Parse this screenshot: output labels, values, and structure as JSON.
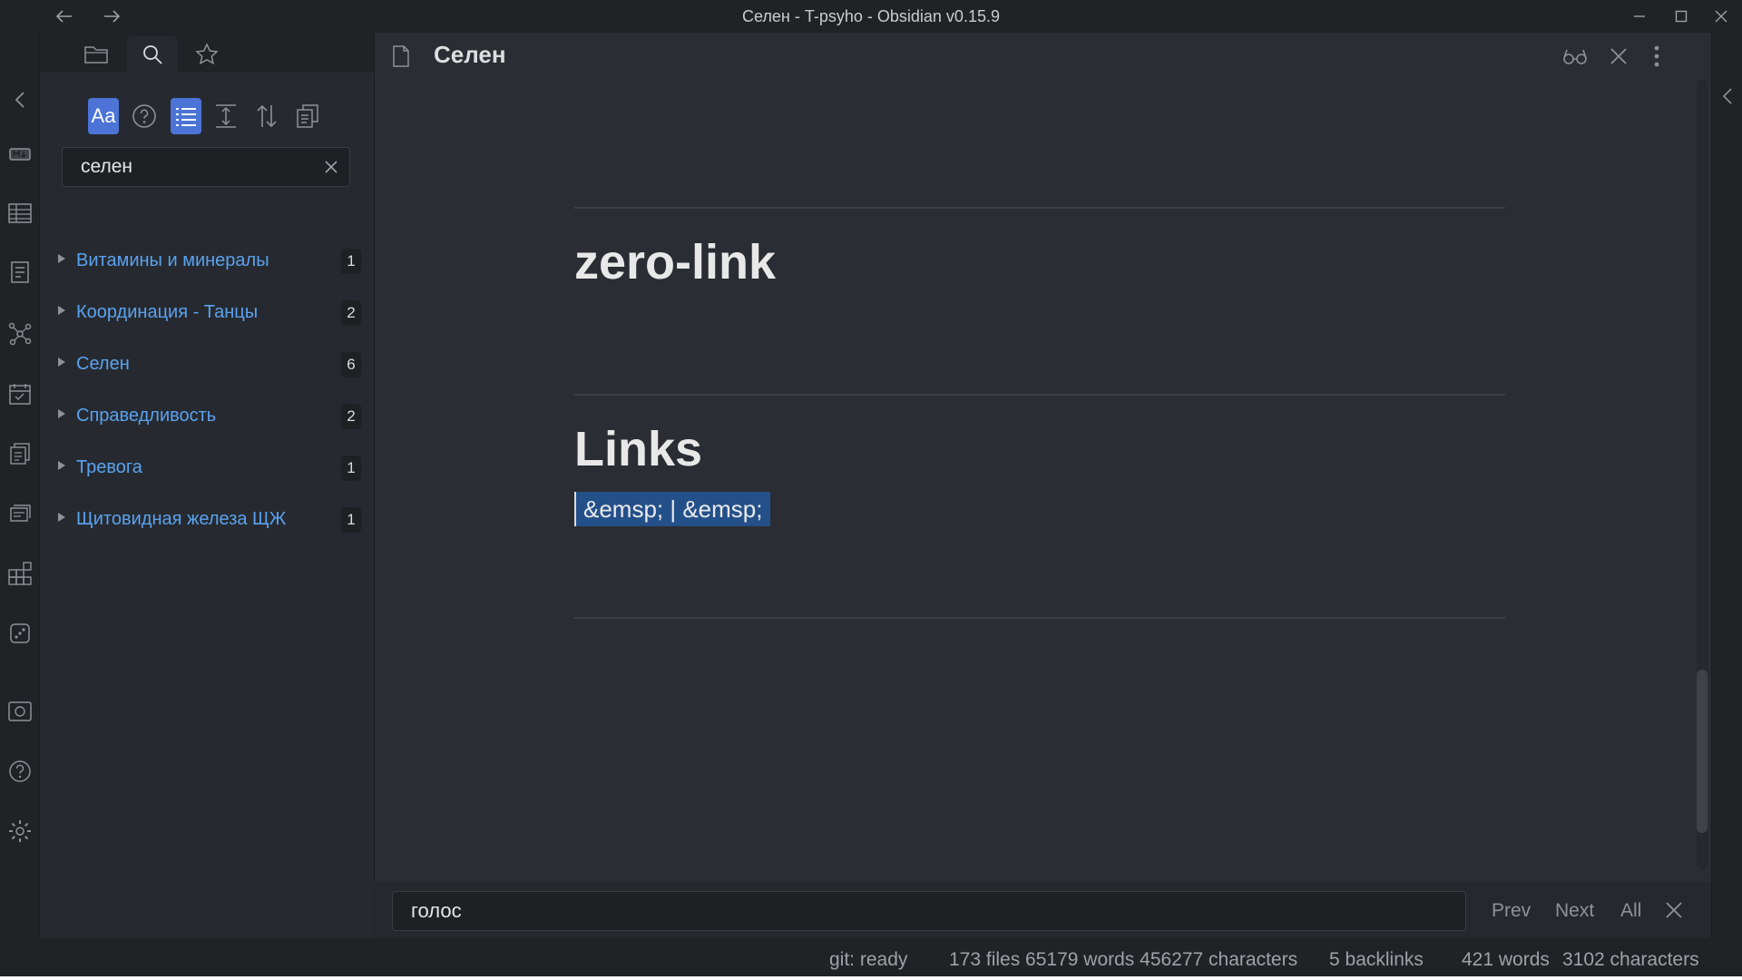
{
  "window": {
    "title": "Селен - T-psyho - Obsidian v0.15.9"
  },
  "sidebar": {
    "search_value": "селен",
    "results": [
      {
        "label": "Витамины и минералы",
        "count": "1"
      },
      {
        "label": "Координация - Танцы",
        "count": "2"
      },
      {
        "label": "Селен",
        "count": "6"
      },
      {
        "label": "Справедливость",
        "count": "2"
      },
      {
        "label": "Тревога",
        "count": "1"
      },
      {
        "label": "Щитовидная железа ЩЖ",
        "count": "1"
      }
    ],
    "tool_aa": "Aa"
  },
  "editor": {
    "title": "Селен",
    "heading1": "zero-link",
    "heading2": "Links",
    "selected_line": "&emsp; | &emsp;"
  },
  "findbar": {
    "query": "голос",
    "prev": "Prev",
    "next": "Next",
    "all": "All"
  },
  "status": {
    "git": "git: ready",
    "vault": "173 files 65179 words 456277 characters",
    "backlinks": "5 backlinks",
    "words": "421 words",
    "chars": "3102 characters"
  },
  "colors": {
    "accent": "#4b74d6",
    "link": "#5aa2ef",
    "selection": "#24508a"
  }
}
